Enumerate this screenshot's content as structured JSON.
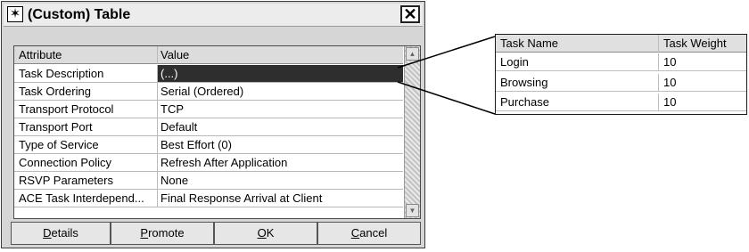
{
  "window": {
    "title": "(Custom) Table",
    "title_icon": "✶",
    "close_glyph": "✕"
  },
  "attributes": {
    "headers": {
      "attribute": "Attribute",
      "value": "Value"
    },
    "rows": [
      {
        "attribute": "Task Description",
        "value": "(...)",
        "selected": true
      },
      {
        "attribute": "Task Ordering",
        "value": "Serial (Ordered)"
      },
      {
        "attribute": "Transport Protocol",
        "value": "TCP"
      },
      {
        "attribute": "Transport Port",
        "value": "Default"
      },
      {
        "attribute": "Type of Service",
        "value": "Best Effort (0)"
      },
      {
        "attribute": "Connection Policy",
        "value": "Refresh After Application"
      },
      {
        "attribute": "RSVP Parameters",
        "value": "None"
      },
      {
        "attribute": "ACE Task Interdepend...",
        "value": "Final Response Arrival at Client"
      }
    ],
    "scroll_up": "▲",
    "scroll_down": "▼"
  },
  "buttons": {
    "details": {
      "mnemonic": "D",
      "rest": "etails"
    },
    "promote": {
      "mnemonic": "P",
      "rest": "romote"
    },
    "ok": {
      "mnemonic": "O",
      "rest": "K"
    },
    "cancel": {
      "mnemonic": "C",
      "rest": "ancel"
    }
  },
  "task_table": {
    "headers": {
      "name": "Task Name",
      "weight": "Task Weight"
    },
    "rows": [
      {
        "name": "Login",
        "weight": "10"
      },
      {
        "name": "Browsing",
        "weight": "10"
      },
      {
        "name": "Purchase",
        "weight": "10"
      }
    ]
  }
}
